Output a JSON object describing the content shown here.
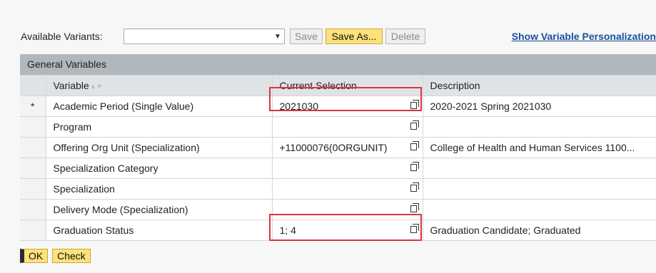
{
  "variants": {
    "label": "Available Variants:",
    "selected": "",
    "save_label": "Save",
    "save_as_label": "Save As...",
    "delete_label": "Delete",
    "personalization_link": "Show Variable Personalization"
  },
  "table": {
    "group_title": "General Variables",
    "columns": {
      "variable": "Variable",
      "current_selection": "Current Selection",
      "description": "Description"
    },
    "rows": [
      {
        "mark": "*",
        "variable": "Academic Period (Single Value)",
        "selection": "2021030",
        "description": "2020-2021 Spring 2021030"
      },
      {
        "mark": "",
        "variable": "Program",
        "selection": "",
        "description": ""
      },
      {
        "mark": "",
        "variable": "Offering Org Unit (Specialization)",
        "selection": "+11000076(0ORGUNIT)",
        "description": "College of Health and Human Services 1100..."
      },
      {
        "mark": "",
        "variable": "Specialization Category",
        "selection": "",
        "description": ""
      },
      {
        "mark": "",
        "variable": "Specialization",
        "selection": "",
        "description": ""
      },
      {
        "mark": "",
        "variable": "Delivery Mode (Specialization)",
        "selection": "",
        "description": ""
      },
      {
        "mark": "",
        "variable": "Graduation Status",
        "selection": "1; 4",
        "description": "Graduation Candidate; Graduated"
      }
    ]
  },
  "footer": {
    "ok_label": "OK",
    "check_label": "Check"
  },
  "colors": {
    "highlight": "#d9363e",
    "primary_button": "#fbe27a",
    "link": "#1b4f9c"
  }
}
